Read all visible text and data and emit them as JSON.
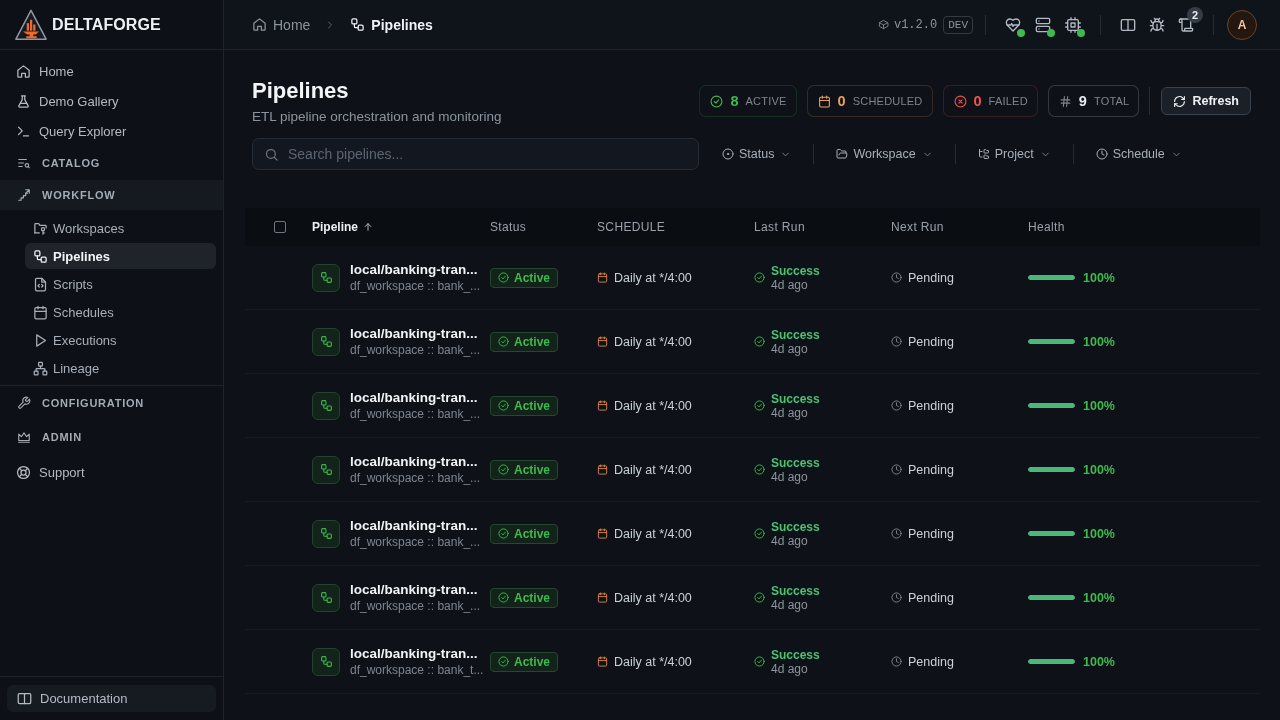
{
  "sidebar": {
    "brand": "DELTAFORGE",
    "items": [
      {
        "kind": "link",
        "label": "Home",
        "selected": false
      },
      {
        "kind": "link",
        "label": "Demo Gallery",
        "selected": false
      },
      {
        "kind": "link",
        "label": "Query Explorer",
        "selected": false
      },
      {
        "kind": "section",
        "label": "CATALOG",
        "expanded": false
      },
      {
        "kind": "section",
        "label": "WORKFLOW",
        "expanded": true,
        "children": [
          {
            "label": "Workspaces",
            "selected": false
          },
          {
            "label": "Pipelines",
            "selected": true
          },
          {
            "label": "Scripts",
            "selected": false
          },
          {
            "label": "Schedules",
            "selected": false
          },
          {
            "label": "Executions",
            "selected": false
          },
          {
            "label": "Lineage",
            "selected": false
          }
        ]
      },
      {
        "kind": "section",
        "label": "CONFIGURATION",
        "expanded": false
      },
      {
        "kind": "section",
        "label": "ADMIN",
        "expanded": false
      },
      {
        "kind": "link",
        "label": "Support",
        "selected": false
      }
    ],
    "footer_link": "Documentation"
  },
  "header": {
    "breadcrumb": [
      {
        "label": "Home",
        "current": false
      },
      {
        "label": "Pipelines",
        "current": true
      }
    ],
    "version": "v1.2.0",
    "environment": "DEV",
    "services": [
      {
        "color": "#3fb950"
      },
      {
        "color": "#3fb950"
      },
      {
        "color": "#3fb950"
      }
    ],
    "notification_count": "2",
    "avatar": "A"
  },
  "page": {
    "title": "Pipelines",
    "subtitle": "ETL pipeline orchestration and monitoring",
    "stats": [
      {
        "kind": "active",
        "value": "8",
        "label": "ACTIVE",
        "color": "#3fb950"
      },
      {
        "kind": "scheduled",
        "value": "0",
        "label": "SCHEDULED",
        "color": "#e8a05c"
      },
      {
        "kind": "failed",
        "value": "0",
        "label": "FAILED",
        "color": "#f85149"
      },
      {
        "kind": "total",
        "value": "9",
        "label": "TOTAL",
        "color": "#e6edf3"
      }
    ],
    "refresh_button": "Refresh",
    "search": {
      "placeholder": "Search pipelines..."
    },
    "filters": [
      "Status",
      "Workspace",
      "Project",
      "Schedule"
    ]
  },
  "table": {
    "select_all_checked": false,
    "columns": [
      {
        "label": "Pipeline",
        "sorted": true,
        "ascending": true
      },
      {
        "label": "Status",
        "sorted": false
      },
      {
        "label": "SCHEDULE",
        "sorted": false
      },
      {
        "label": "Last Run",
        "sorted": false
      },
      {
        "label": "Next Run",
        "sorted": false
      },
      {
        "label": "Health",
        "sorted": false
      }
    ],
    "rows": [
      {
        "name": "local/banking-tran...",
        "path": "df_workspace :: bank_...",
        "status": "Active",
        "schedule": "Daily at */4:00",
        "last_run": {
          "status": "Success",
          "ago": "4d ago"
        },
        "next_run": "Pending",
        "health": {
          "level": 1,
          "reading": "100%"
        }
      },
      {
        "name": "local/banking-tran...",
        "path": "df_workspace :: bank_...",
        "status": "Active",
        "schedule": "Daily at */4:00",
        "last_run": {
          "status": "Success",
          "ago": "4d ago"
        },
        "next_run": "Pending",
        "health": {
          "level": 1,
          "reading": "100%"
        }
      },
      {
        "name": "local/banking-tran...",
        "path": "df_workspace :: bank_...",
        "status": "Active",
        "schedule": "Daily at */4:00",
        "last_run": {
          "status": "Success",
          "ago": "4d ago"
        },
        "next_run": "Pending",
        "health": {
          "level": 1,
          "reading": "100%"
        }
      },
      {
        "name": "local/banking-tran...",
        "path": "df_workspace :: bank_...",
        "status": "Active",
        "schedule": "Daily at */4:00",
        "last_run": {
          "status": "Success",
          "ago": "4d ago"
        },
        "next_run": "Pending",
        "health": {
          "level": 1,
          "reading": "100%"
        }
      },
      {
        "name": "local/banking-tran...",
        "path": "df_workspace :: bank_...",
        "status": "Active",
        "schedule": "Daily at */4:00",
        "last_run": {
          "status": "Success",
          "ago": "4d ago"
        },
        "next_run": "Pending",
        "health": {
          "level": 1,
          "reading": "100%"
        }
      },
      {
        "name": "local/banking-tran...",
        "path": "df_workspace :: bank_...",
        "status": "Active",
        "schedule": "Daily at */4:00",
        "last_run": {
          "status": "Success",
          "ago": "4d ago"
        },
        "next_run": "Pending",
        "health": {
          "level": 1,
          "reading": "100%"
        }
      },
      {
        "name": "local/banking-tran...",
        "path": "df_workspace :: bank_t...",
        "status": "Active",
        "schedule": "Daily at */4:00",
        "last_run": {
          "status": "Success",
          "ago": "4d ago"
        },
        "next_run": "Pending",
        "health": {
          "level": 1,
          "reading": "100%"
        }
      }
    ]
  }
}
